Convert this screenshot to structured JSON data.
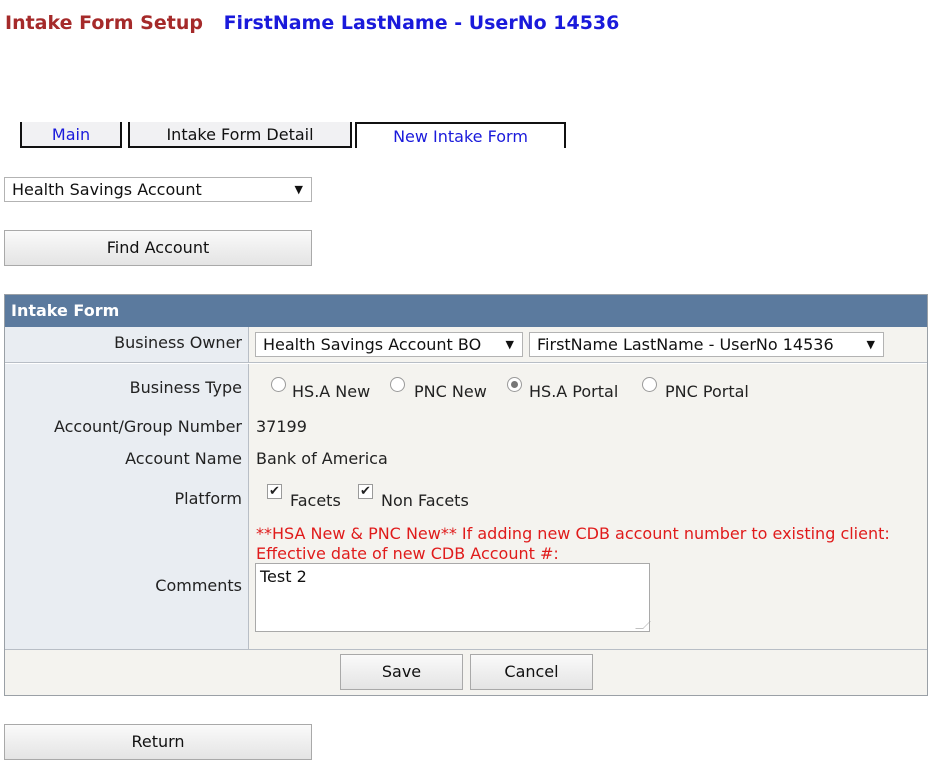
{
  "header": {
    "title": "Intake Form Setup",
    "user": "FirstName LastName - UserNo 14536"
  },
  "tabs": [
    {
      "label": "Main"
    },
    {
      "label": "Intake Form Detail"
    },
    {
      "label": "New Intake Form"
    }
  ],
  "account_type_select": {
    "value": "Health Savings Account"
  },
  "find_account_button": {
    "label": "Find Account"
  },
  "form": {
    "heading": "Intake Form",
    "business_owner": {
      "label": "Business Owner",
      "owner_select": "Health Savings Account BO",
      "user_select": "FirstName LastName - UserNo 14536"
    },
    "business_type": {
      "label": "Business Type",
      "options": [
        "HS.A New",
        "PNC New",
        "HS.A Portal",
        "PNC Portal"
      ],
      "selected": "HS.A Portal"
    },
    "account_group_number": {
      "label": "Account/Group Number",
      "value": "37199"
    },
    "account_name": {
      "label": "Account Name",
      "value": "Bank of America"
    },
    "platform": {
      "label": "Platform",
      "options": [
        {
          "label": "Facets",
          "checked": true
        },
        {
          "label": "Non Facets",
          "checked": true
        }
      ]
    },
    "comments": {
      "label": "Comments",
      "note": "**HSA New & PNC New** If adding new CDB account number to existing client: Effective date of new CDB Account #:",
      "value": "Test 2"
    },
    "save_label": "Save",
    "cancel_label": "Cancel"
  },
  "return_button": {
    "label": "Return"
  },
  "icons": {
    "dropdown": "triangle-down",
    "check": "check-mark"
  }
}
